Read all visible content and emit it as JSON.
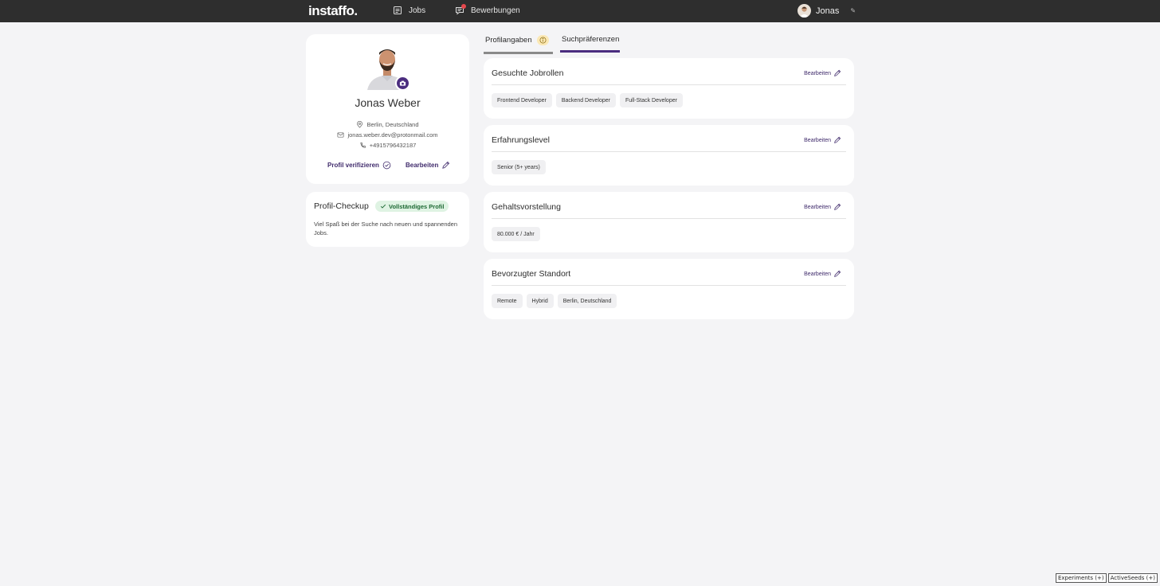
{
  "header": {
    "logo": "instaffo.",
    "nav": [
      {
        "label": "Jobs",
        "icon": "list-icon"
      },
      {
        "label": "Bewerbungen",
        "icon": "applications-icon"
      }
    ],
    "user": {
      "name": "Jonas"
    }
  },
  "profile": {
    "name": "Jonas Weber",
    "location": "Berlin, Deutschland",
    "email": "jonas.weber.dev@protonmail.com",
    "phone": "+4915796432187",
    "verify_label": "Profil verifizieren",
    "edit_label": "Bearbeiten"
  },
  "checkup": {
    "title": "Profil-Checkup",
    "badge": "Vollständiges Profil",
    "text": "Viel Spaß bei der Suche nach neuen und spannenden Jobs."
  },
  "tabs": [
    {
      "label": "Profilangaben",
      "active": false
    },
    {
      "label": "Suchpräferenzen",
      "active": true
    }
  ],
  "preferences": [
    {
      "title": "Gesuchte Jobrollen",
      "edit": "Bearbeiten",
      "chips": [
        "Frontend Developer",
        "Backend Developer",
        "Full-Stack Developer"
      ]
    },
    {
      "title": "Erfahrungslevel",
      "edit": "Bearbeiten",
      "chips": [
        "Senior (5+ years)"
      ]
    },
    {
      "title": "Gehaltsvorstellung",
      "edit": "Bearbeiten",
      "chips": [
        "80.000 € / Jahr"
      ]
    },
    {
      "title": "Bevorzugter Standort",
      "edit": "Bearbeiten",
      "chips": [
        "Remote",
        "Hybrid",
        "Berlin, Deutschland"
      ]
    }
  ],
  "debug": {
    "experiments": "Experiments (+)",
    "active_seeds": "ActiveSeeds (+)"
  },
  "colors": {
    "accent": "#4b2d7f",
    "topbar": "#2e2e2e",
    "success_bg": "#dff3e3"
  }
}
